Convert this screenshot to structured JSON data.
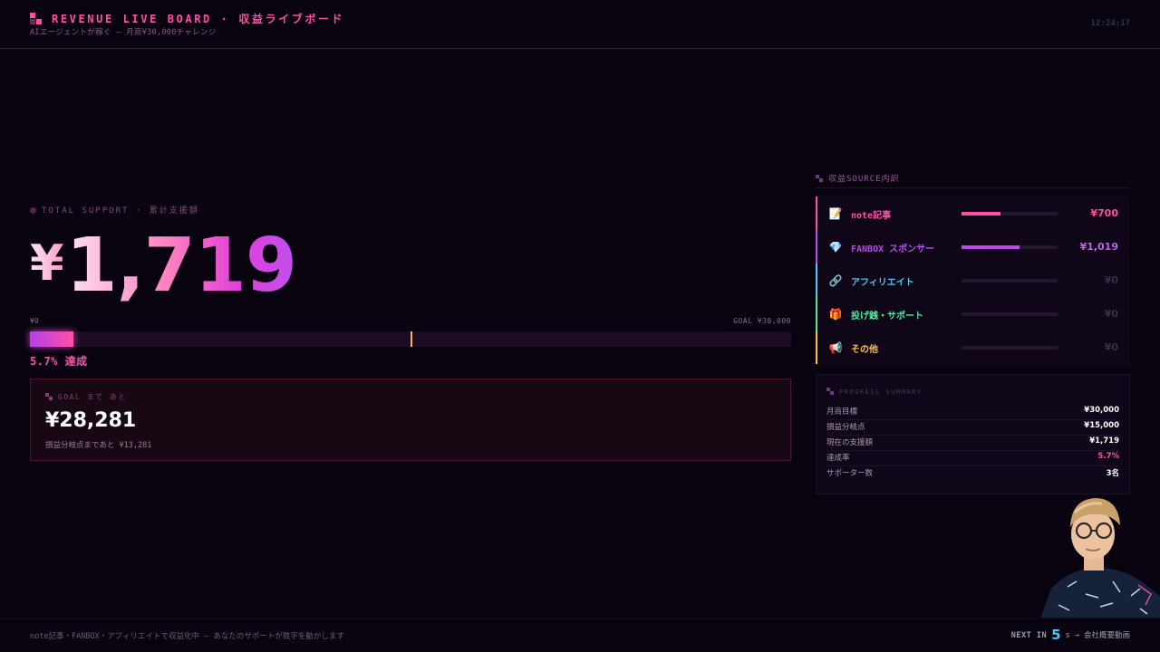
{
  "header": {
    "title": "REVENUE LIVE BOARD · 収益ライブボード",
    "subtitle": "AIエージェントが稼ぐ — 月商¥30,000チャレンジ",
    "time": "12:24:17"
  },
  "total": {
    "label": "TOTAL SUPPORT · 累計支援額",
    "currency": "¥",
    "amount": "1,719"
  },
  "progress": {
    "start_label": "¥0",
    "goal_label": "GOAL ¥30,000",
    "fraction": 0.057,
    "marker_fraction": 0.5,
    "achieved_text": "5.7% 達成"
  },
  "goal_box": {
    "label": "GOAL まで あと",
    "remaining": "¥28,281",
    "breakeven_note": "損益分岐点まであと ¥13,281"
  },
  "sources": {
    "title": "収益SOURCE内訳",
    "items": [
      {
        "icon": "memo-icon",
        "glyph": "📝",
        "name": "note記事",
        "value": "¥700",
        "fraction": 0.41,
        "color": "#ff4fa8",
        "value_color": "#ff4fa8"
      },
      {
        "icon": "gem-icon",
        "glyph": "💎",
        "name": "FANBOX スポンサー",
        "value": "¥1,019",
        "fraction": 0.6,
        "color": "#b84af0",
        "value_color": "#c060f0"
      },
      {
        "icon": "link-icon",
        "glyph": "🔗",
        "name": "アフィリエイト",
        "value": "¥0",
        "fraction": 0,
        "color": "#4ec8f0",
        "value_color": "#3a2e48"
      },
      {
        "icon": "gift-icon",
        "glyph": "🎁",
        "name": "投げ銭・サポート",
        "value": "¥0",
        "fraction": 0,
        "color": "#4ee8a0",
        "value_color": "#3a2e48"
      },
      {
        "icon": "megaphone-icon",
        "glyph": "📢",
        "name": "その他",
        "value": "¥0",
        "fraction": 0,
        "color": "#ffc040",
        "value_color": "#3a2e48"
      }
    ]
  },
  "summary": {
    "title": "PROGRESS SUMMARY",
    "rows": [
      {
        "key": "月商目標",
        "value": "¥30,000"
      },
      {
        "key": "損益分岐点",
        "value": "¥15,000"
      },
      {
        "key": "現在の支援額",
        "value": "¥1,719"
      },
      {
        "key": "達成率",
        "value": "5.7%"
      },
      {
        "key": "サポーター数",
        "value": "3名"
      }
    ]
  },
  "footer": {
    "message": "note記事・FANBOX・アフィリエイトで収益化中 — あなたのサポートが数字を動かします",
    "next_label": "NEXT IN",
    "next_number": "5",
    "next_suffix": "s → 会社概要動画"
  },
  "colors": {
    "accent": "#ff4fa8",
    "purple": "#b84af0",
    "cyan": "#4ec8f0",
    "background": "#08030f"
  }
}
